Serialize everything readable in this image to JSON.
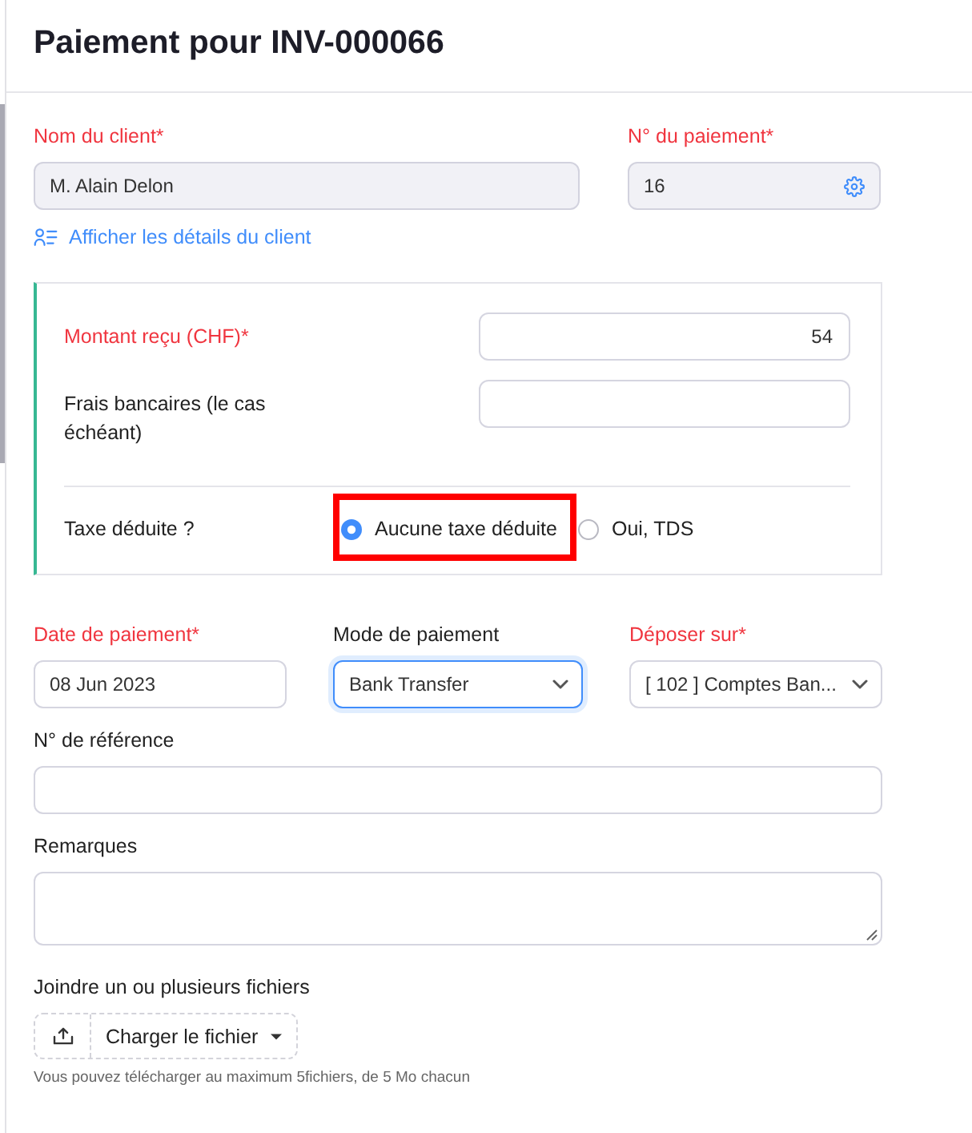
{
  "header": {
    "title": "Paiement pour INV-000066"
  },
  "customer_row": [
    {
      "kind": "text",
      "label": "Nom du client*",
      "required": true,
      "value": "M. Alain Delon",
      "readonly": true
    },
    {
      "kind": "setting",
      "label": "N° du paiement*",
      "required": true,
      "value": "16",
      "readonly": true
    }
  ],
  "details_link": {
    "label": "Afficher les détails du client"
  },
  "amount_panel": {
    "fields": [
      {
        "label": "Montant reçu (CHF)*",
        "required": true,
        "value": "54"
      },
      {
        "label": "Frais bancaires (le cas échéant)",
        "required": false
      }
    ],
    "tax": {
      "label": "Taxe déduite ?",
      "options": [
        {
          "label": "Aucune taxe déduite",
          "selected": true,
          "highlighted": true
        },
        {
          "label": "Oui, TDS",
          "selected": false,
          "highlighted": false
        }
      ]
    }
  },
  "payment_row": [
    {
      "kind": "date",
      "label": "Date de paiement*",
      "required": true,
      "value": "08 Jun 2023",
      "focused": false
    },
    {
      "kind": "select",
      "label": "Mode de paiement",
      "required": false,
      "value": "Bank Transfer",
      "focused": true
    },
    {
      "kind": "select",
      "label": "Déposer sur*",
      "required": true,
      "value": "[ 102 ] Comptes Ban...",
      "focused": false
    }
  ],
  "reference": {
    "label": "N° de référence",
    "required": false
  },
  "notes": {
    "label": "Remarques",
    "required": false
  },
  "attachments": {
    "label": "Joindre un ou plusieurs fichiers",
    "button": "Charger le fichier",
    "hint": "Vous pouvez télécharger au maximum 5fichiers, de 5 Mo chacun"
  }
}
